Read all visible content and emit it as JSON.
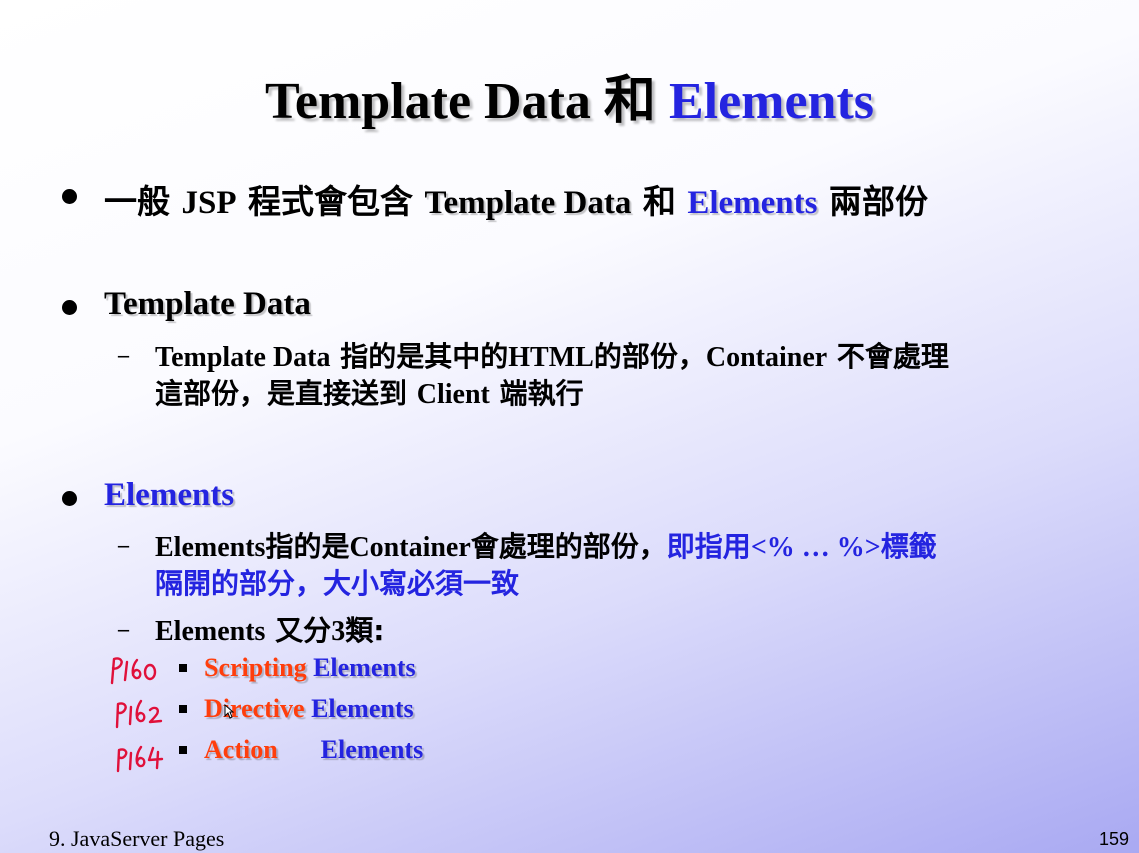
{
  "title": {
    "part1": "Template Data ",
    "cjk": "和",
    "part2": " Elements"
  },
  "bullets": {
    "b1": {
      "t1": "一般 ",
      "t2": "JSP",
      "t3": " 程式會包含 ",
      "t4": "Template Data",
      "t5": " 和 ",
      "t6": "Elements",
      "t7": " 兩部份"
    },
    "b2": {
      "heading": "Template Data",
      "sub1": {
        "l1a": "Template Data",
        "l1b": " 指的是其中的",
        "l1c": "HTML",
        "l1d": "的部份，",
        "l1e": "Container",
        "l1f": " 不會處理",
        "l2a": "這部份，是直接送到 ",
        "l2b": "Client",
        "l2c": " 端執行"
      }
    },
    "b3": {
      "heading": "Elements",
      "sub1": {
        "l1a": "Elements",
        "l1b": "指的是",
        "l1c": "Container",
        "l1d": "會處理的部份，",
        "l1e": "即指用",
        "l1f": "<% … %>",
        "l1g": "標籤",
        "l2": "隔開的部分，大小寫必須一致"
      },
      "sub2": {
        "a": "Elements",
        "b": " 又分",
        "c": "3",
        "d": "類:"
      },
      "items": [
        {
          "red": "Scripting",
          "blue": " Elements"
        },
        {
          "red": "Directive",
          "blue": " Elements"
        },
        {
          "red": "Action",
          "blue": "Elements"
        }
      ]
    }
  },
  "annotations": [
    "P160",
    "P162",
    "P164"
  ],
  "colors": {
    "accent_blue": "#2424e0",
    "accent_red": "#ff3e0c",
    "annotation_red": "#e0103a"
  },
  "footer": {
    "left": "9. JavaServer Pages",
    "page": "159"
  }
}
